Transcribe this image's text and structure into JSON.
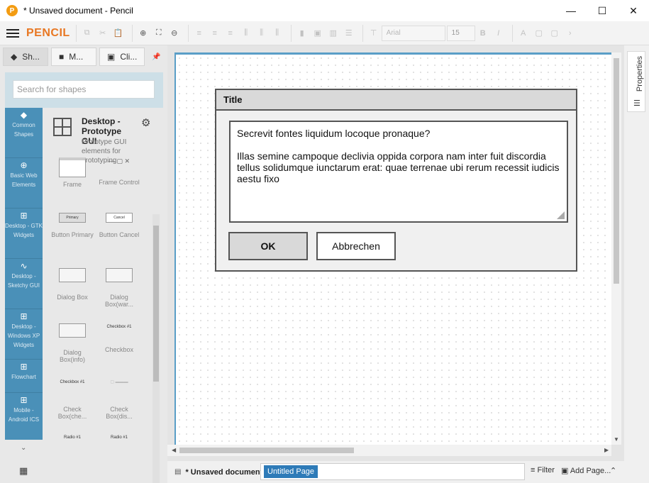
{
  "window": {
    "title": "* Unsaved document - Pencil",
    "logo": "P",
    "controls": {
      "minimize": "—",
      "maximize": "☐",
      "close": "✕"
    }
  },
  "toolbar": {
    "brand": "PENCIL",
    "font_name": "Arial",
    "font_size": "15",
    "bold": "B",
    "italic": "I",
    "font_color": "A"
  },
  "left_panel": {
    "tabs": [
      {
        "label": "Sh...",
        "icon": "layers-icon",
        "glyph": "◆"
      },
      {
        "label": "M...",
        "icon": "briefcase-icon",
        "glyph": "■"
      },
      {
        "label": "Cli...",
        "icon": "image-icon",
        "glyph": "▣"
      }
    ],
    "pin": "📌",
    "search": {
      "placeholder": "Search for shapes"
    },
    "categories": [
      {
        "label": "Common Shapes",
        "glyph": "◆"
      },
      {
        "label": "Basic Web Elements",
        "glyph": "⊕"
      },
      {
        "label": "Desktop - GTK Widgets",
        "glyph": "⊞"
      },
      {
        "label": "Desktop - Sketchy GUI",
        "glyph": "∿"
      },
      {
        "label": "Desktop - Windows XP Widgets",
        "glyph": "⊞"
      },
      {
        "label": "Flowchart",
        "glyph": "⊞"
      },
      {
        "label": "Mobile - Android ICS",
        "glyph": "⊞"
      }
    ],
    "more_glyph": "⌄",
    "apps_glyph": "▦",
    "collection": {
      "title": "Desktop - Prototype GUI",
      "description": "Prototype GUI elements for prototyping",
      "gear": "⚙"
    },
    "shapes": [
      {
        "label": "Frame"
      },
      {
        "label": "Frame Control"
      },
      {
        "label": "Button Primary",
        "text": "Primary"
      },
      {
        "label": "Button Cancel",
        "text": "Cancel"
      },
      {
        "label": "Dialog Box"
      },
      {
        "label": "Dialog Box(war..."
      },
      {
        "label": "Dialog Box(info)"
      },
      {
        "label": "Checkbox",
        "text": "Checkbox #1"
      },
      {
        "label": "Check Box(che...",
        "text": "Checkbox #1"
      },
      {
        "label": "Check Box(dis..."
      },
      {
        "label": "",
        "text": "Radio #1"
      },
      {
        "label": "",
        "text": "Radio #1"
      }
    ]
  },
  "dialog": {
    "title": "Title",
    "question": "Secrevit fontes liquidum locoque pronaque?",
    "body": "Illas semine campoque declivia oppida corpora nam inter fuit discordia tellus solidumque iunctarum erat: quae terrenae ubi rerum recessit iudicis aestu fixo",
    "ok_label": "OK",
    "cancel_label": "Abbrechen"
  },
  "right_panel": {
    "properties_label": "Properties",
    "sliders_glyph": "☰"
  },
  "bottom_bar": {
    "document_label": "* Unsaved document",
    "page_name": "Untitled Page",
    "filter_label": "Filter",
    "add_page_label": "Add Page...",
    "collapse_glyph": "⌃"
  }
}
